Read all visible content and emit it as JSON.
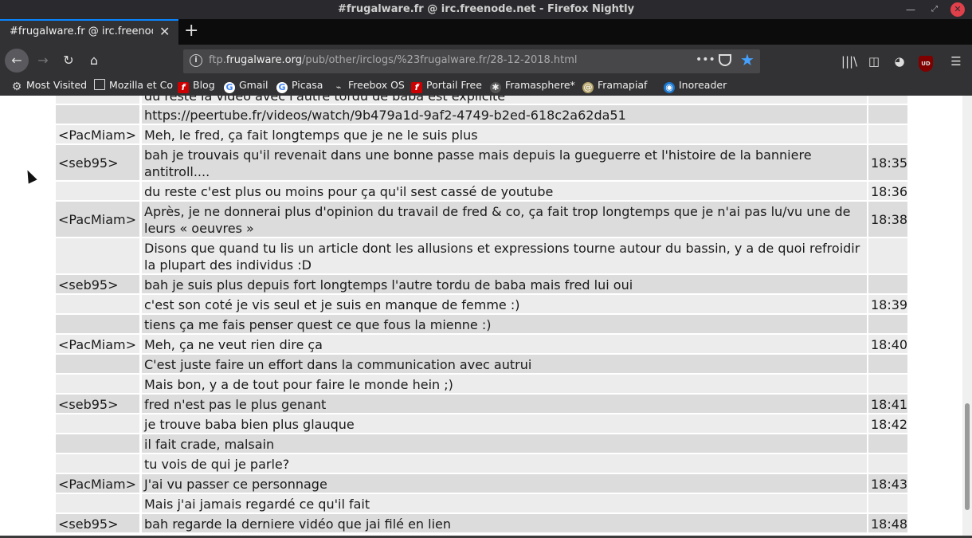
{
  "window": {
    "title": "#frugalware.fr @ irc.freenode.net - Firefox Nightly"
  },
  "tab": {
    "title": "#frugalware.fr @ irc.freenode.",
    "close": "✕"
  },
  "newtab": "+",
  "nav": {
    "back": "←",
    "forward": "→",
    "reload": "↻",
    "home": "⌂"
  },
  "url": {
    "prefix": "ftp.",
    "domain": "frugalware.org",
    "path": "/pub/other/irclogs/%23frugalware.fr/28-12-2018.html",
    "more": "•••",
    "star": "★",
    "info": "i"
  },
  "toolbar": {
    "library": "|||\\",
    "sidebar": "◫",
    "ext": "◕",
    "ublock": "UD",
    "menu": "☰"
  },
  "bookmarks": [
    {
      "label": "Most Visited",
      "icon": "gear-icon",
      "glyph": "⚙",
      "cls": "ic-gear"
    },
    {
      "label": "Mozilla et Co",
      "icon": "folder-icon",
      "glyph": "",
      "cls": "ic-folder"
    },
    {
      "label": "Blog",
      "icon": "flash-icon",
      "glyph": "f",
      "cls": "ic-flash"
    },
    {
      "label": "Gmail",
      "icon": "google-icon",
      "glyph": "G",
      "cls": "ic-google"
    },
    {
      "label": "Picasa",
      "icon": "google-icon",
      "glyph": "G",
      "cls": "ic-google"
    },
    {
      "label": "Freebox OS",
      "icon": "freebox-icon",
      "glyph": "⌁",
      "cls": "ic-freebox"
    },
    {
      "label": "Portail Free",
      "icon": "flash-icon",
      "glyph": "f",
      "cls": "ic-flash"
    },
    {
      "label": "Framasphere*",
      "icon": "framasphere-icon",
      "glyph": "✱",
      "cls": "ic-frama"
    },
    {
      "label": "Framapiaf",
      "icon": "framapiaf-icon",
      "glyph": "@",
      "cls": "ic-framapiaf"
    },
    {
      "label": "Inoreader",
      "icon": "inoreader-icon",
      "glyph": "◉",
      "cls": "ic-ino"
    }
  ],
  "log": [
    {
      "nick": "",
      "msg": "du reste la vidéo avec l'autre tordu de baba est explicite",
      "time": ""
    },
    {
      "nick": "",
      "msg": "https://peertube.fr/videos/watch/9b479a1d-9af2-4749-b2ed-618c2a62da51",
      "time": ""
    },
    {
      "nick": "<PacMiam>",
      "msg": "Meh, le fred, ça fait longtemps que je ne le suis plus",
      "time": ""
    },
    {
      "nick": "<seb95>",
      "msg": "bah je trouvais qu'il revenait dans une bonne passe mais depuis la gueguerre et l'histoire de la banniere antitroll....",
      "time": "18:35"
    },
    {
      "nick": "",
      "msg": "du reste c'est plus ou moins pour ça qu'il sest cassé de youtube",
      "time": "18:36"
    },
    {
      "nick": "<PacMiam>",
      "msg": "Après, je ne donnerai plus d'opinion du travail de fred & co, ça fait trop longtemps que je n'ai pas lu/vu une de leurs « oeuvres »",
      "time": "18:38"
    },
    {
      "nick": "",
      "msg": "Disons que quand tu lis un article dont les allusions et expressions tourne autour du bassin, y a de quoi refroidir la plupart des individus :D",
      "time": ""
    },
    {
      "nick": "<seb95>",
      "msg": "bah je suis plus depuis fort longtemps l'autre tordu de baba mais fred lui oui",
      "time": ""
    },
    {
      "nick": "",
      "msg": "c'est son coté je vis seul et je suis en manque de femme :)",
      "time": "18:39"
    },
    {
      "nick": "",
      "msg": "tiens ça me fais penser quest ce que fous la mienne :)",
      "time": ""
    },
    {
      "nick": "<PacMiam>",
      "msg": "Meh, ça ne veut rien dire ça",
      "time": "18:40"
    },
    {
      "nick": "",
      "msg": "C'est juste faire un effort dans la communication avec autrui",
      "time": ""
    },
    {
      "nick": "",
      "msg": "Mais bon, y a de tout pour faire le monde hein ;)",
      "time": ""
    },
    {
      "nick": "<seb95>",
      "msg": "fred n'est pas le plus genant",
      "time": "18:41"
    },
    {
      "nick": "",
      "msg": "je trouve baba bien plus glauque",
      "time": "18:42"
    },
    {
      "nick": "",
      "msg": "il fait crade, malsain",
      "time": ""
    },
    {
      "nick": "",
      "msg": "tu vois de qui je parle?",
      "time": ""
    },
    {
      "nick": "<PacMiam>",
      "msg": "J'ai vu passer ce personnage",
      "time": "18:43"
    },
    {
      "nick": "",
      "msg": "Mais j'ai jamais regardé ce qu'il fait",
      "time": ""
    },
    {
      "nick": "<seb95>",
      "msg": "bah regarde la derniere vidéo que jai filé en lien",
      "time": "18:48"
    }
  ]
}
